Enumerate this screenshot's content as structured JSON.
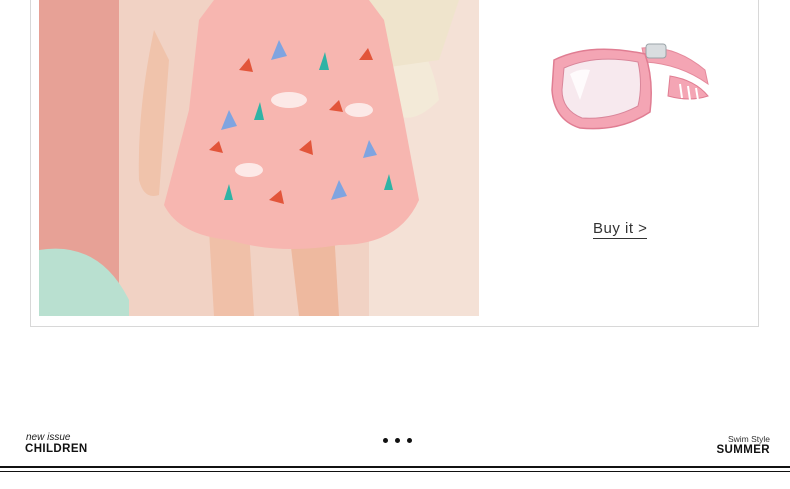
{
  "product": {
    "buy_label": "Buy it >",
    "image_name": "girl-floral-skirt-photo",
    "goggles_name": "pink-swim-goggles"
  },
  "footer": {
    "left_small": "new issue",
    "left_big": "CHILDREN",
    "right_small": "Swim Style",
    "right_big": "SUMMER"
  },
  "colors": {
    "photo_bg": "#f3c9b8",
    "skirt": "#f7b6b0",
    "goggles": "#f4a5b4"
  }
}
